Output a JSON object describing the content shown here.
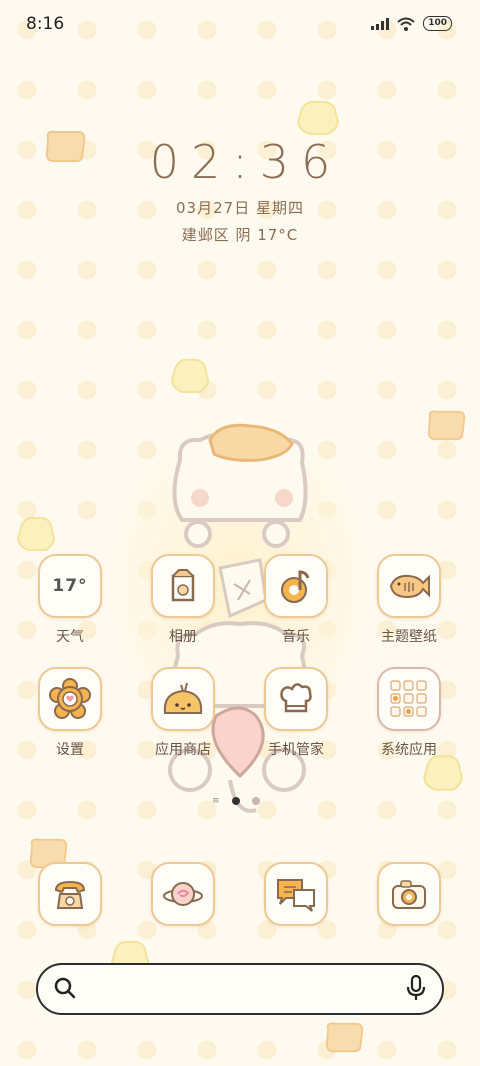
{
  "status_bar": {
    "time": "8:16",
    "battery": "100"
  },
  "clock_widget": {
    "time": "02:36",
    "date": "03月27日 星期四",
    "weather": "建邺区 阴 17°C"
  },
  "apps_row1": [
    {
      "label": "天气",
      "icon": "weather-icon",
      "value": "17°"
    },
    {
      "label": "相册",
      "icon": "photo-album-icon"
    },
    {
      "label": "音乐",
      "icon": "music-note-icon"
    },
    {
      "label": "主题壁纸",
      "icon": "taiyaki-fish-icon"
    }
  ],
  "apps_row2": [
    {
      "label": "设置",
      "icon": "flower-cookie-icon"
    },
    {
      "label": "应用商店",
      "icon": "bun-app-store-icon"
    },
    {
      "label": "手机管家",
      "icon": "chef-hat-icon"
    },
    {
      "label": "系统应用",
      "icon": "folder-grid-icon"
    }
  ],
  "dock": [
    {
      "icon": "telephone-icon"
    },
    {
      "icon": "planet-browser-icon"
    },
    {
      "icon": "chat-bubbles-icon"
    },
    {
      "icon": "camera-icon"
    }
  ],
  "page_indicator": {
    "pages": 2,
    "current": 1
  },
  "search": {
    "placeholder": ""
  },
  "colors": {
    "background": "#fffaf0",
    "tile_border": "#edc995",
    "text": "#6a5546",
    "accent": "#8b6d55"
  }
}
